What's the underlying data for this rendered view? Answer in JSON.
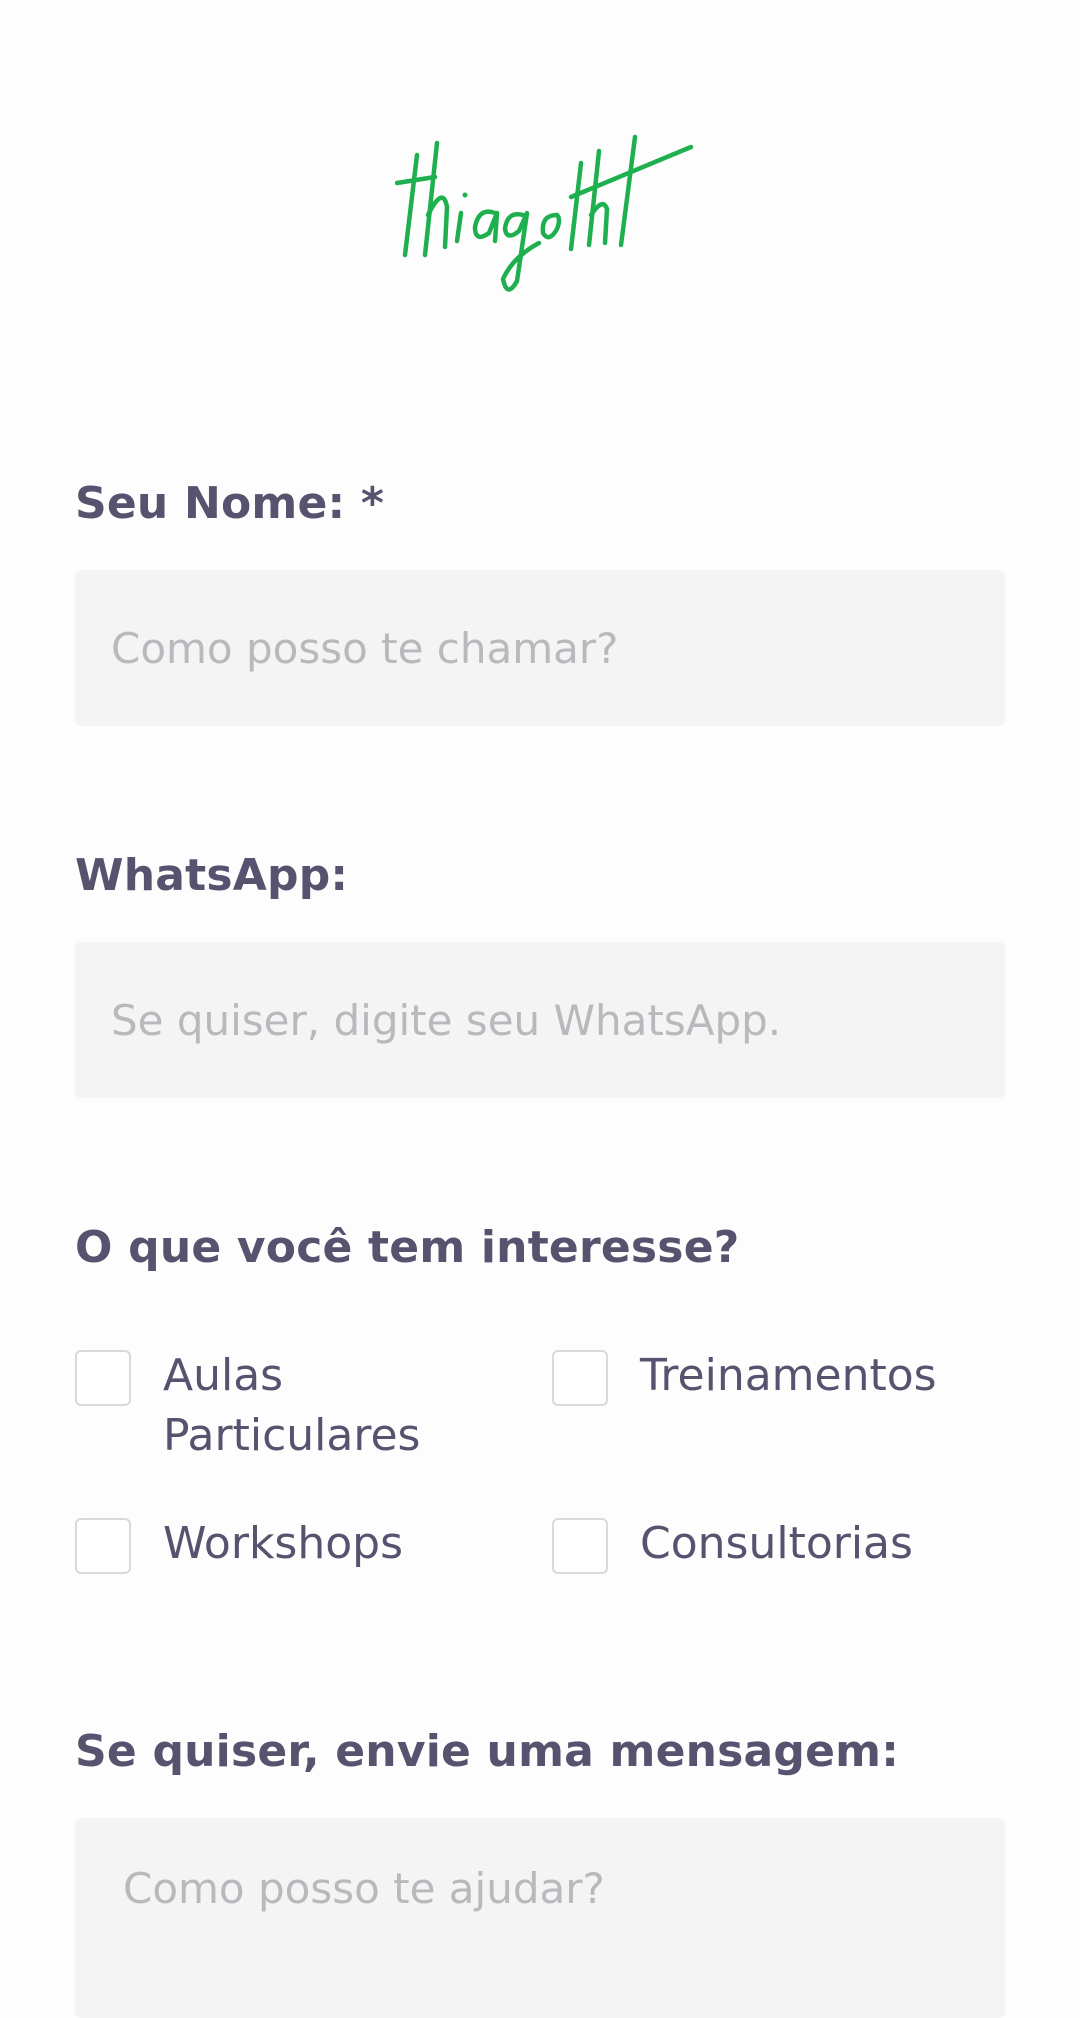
{
  "logo": {
    "text": "thiagotht",
    "color": "#1eb04f"
  },
  "form": {
    "name": {
      "label": "Seu Nome: *",
      "placeholder": "Como posso te chamar?",
      "value": ""
    },
    "whatsapp": {
      "label": "WhatsApp:",
      "placeholder": "Se quiser, digite seu WhatsApp.",
      "value": ""
    },
    "interests": {
      "label": "O que você tem interesse?",
      "options": [
        {
          "label": "Aulas Particulares",
          "checked": false
        },
        {
          "label": "Treinamentos",
          "checked": false
        },
        {
          "label": "Workshops",
          "checked": false
        },
        {
          "label": "Consultorias",
          "checked": false
        }
      ]
    },
    "message": {
      "label": "Se quiser, envie uma mensagem:",
      "placeholder": "Como posso te ajudar?",
      "value": ""
    }
  },
  "colors": {
    "text": "#55536e",
    "input_bg": "#f4f4f4",
    "placeholder": "#b9b9bd",
    "checkbox_border": "#d9d9dd",
    "brand_green": "#1eb04f"
  }
}
